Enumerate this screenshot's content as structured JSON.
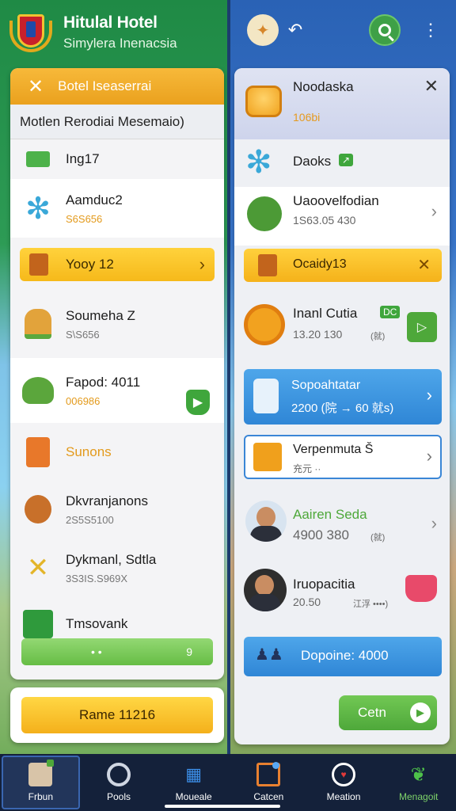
{
  "header": {
    "title": "Hitulal Hotel",
    "subtitle": "Simylera Inenacsia"
  },
  "left_panel": {
    "head_label": "Botel Iseaserrai",
    "sub_label": "Motlen Rerodiai Mesemaio)",
    "rows": [
      {
        "name": "Ing17",
        "value": ""
      },
      {
        "name": "Aamduc2",
        "value": "S6S656"
      },
      {
        "name": "Yooy 12",
        "value": ""
      },
      {
        "name": "Soumeha Z",
        "value": "S\\S656"
      },
      {
        "name": "Fapod: 4011",
        "value": "006986"
      },
      {
        "name": "Sunons",
        "value": ""
      },
      {
        "name": "Dkvranjanons",
        "value": "2S5S5100"
      },
      {
        "name": "Dykmanl, Sdtla",
        "value": "3S3IS.S969X"
      },
      {
        "name": "Tmsovank",
        "value": ""
      }
    ],
    "green_bar": {
      "left": "• •",
      "right": "9"
    },
    "bottom_button": "Rame 11216"
  },
  "right_panel": {
    "head": {
      "title": "Noodaska",
      "sub": "106bi"
    },
    "rows": [
      {
        "name": "Daoks",
        "value": ""
      },
      {
        "name": "Uaoovelfodian",
        "value": "1S63.05  430"
      },
      {
        "name": "Ocaidy13",
        "value": ""
      },
      {
        "name": "Inanl  Cutia",
        "value": "13.20   130",
        "unit": "(就)",
        "badge": "DC"
      },
      {
        "name": "Sopoahtatar",
        "value": "2200  (院 → 60  就s)"
      },
      {
        "name": "Verpenmuta Š",
        "value": "充元 ··"
      },
      {
        "name": "Aairen  Seda",
        "value": "4900   380",
        "unit": "(就)"
      },
      {
        "name": "Iruopacitia",
        "value": "20.50",
        "unit": "江浮 ••••)"
      },
      {
        "name": "Dopoine: 4000",
        "value": ""
      }
    ],
    "cta_button": "Cetn"
  },
  "nav": [
    {
      "label": "Frbun",
      "icon": "avatar-icon"
    },
    {
      "label": "Pools",
      "icon": "ring-icon"
    },
    {
      "label": "Moueale",
      "icon": "grid-icon"
    },
    {
      "label": "Catcen",
      "icon": "bookmark-icon"
    },
    {
      "label": "Meation",
      "icon": "chat-icon"
    },
    {
      "label": "Menagoit",
      "icon": "leaf-icon"
    }
  ],
  "colors": {
    "accent_orange": "#f6b91a",
    "accent_green": "#4ea83a",
    "accent_blue": "#2f86d6",
    "nav_bg": "#14213a"
  }
}
